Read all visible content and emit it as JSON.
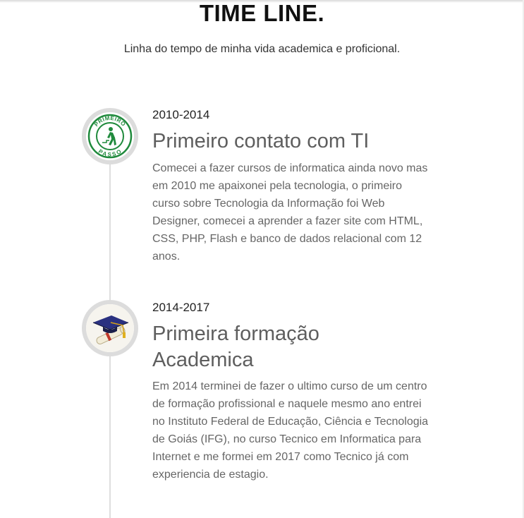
{
  "header": {
    "title": "TIME LINE.",
    "subtitle": "Linha do tempo de minha vida academica e proficional."
  },
  "timeline": {
    "items": [
      {
        "date": "2010-2014",
        "heading": "Primeiro contato com TI",
        "text": "Comecei a fazer cursos de informatica ainda novo mas em 2010 me apaixonei pela tecnologia, o primeiro curso sobre Tecnologia da Informação foi Web Designer, comecei a aprender a fazer site com HTML, CSS, PHP, Flash e banco de dados relacional com 12 anos.",
        "icon": "primeiro-passo-logo-icon",
        "logo_text_top": "PRIMEIRO",
        "logo_text_bottom": "PASSO"
      },
      {
        "date": "2014-2017",
        "heading": "Primeira formação Academica",
        "text": "Em 2014 terminei de fazer o ultimo curso de um centro de formação profissional e naquele mesmo ano entrei no Instituto Federal de Educação, Ciência e Tecnologia de Goiás (IFG), no curso Tecnico em Informatica para Internet e me formei em 2017 como Tecnico já com experiencia de estagio.",
        "icon": "graduation-cap-diploma-icon"
      }
    ]
  },
  "colors": {
    "logo_green": "#1f8a3c",
    "timeline_line": "#dedede",
    "icon_ring": "#dcdcdc"
  }
}
